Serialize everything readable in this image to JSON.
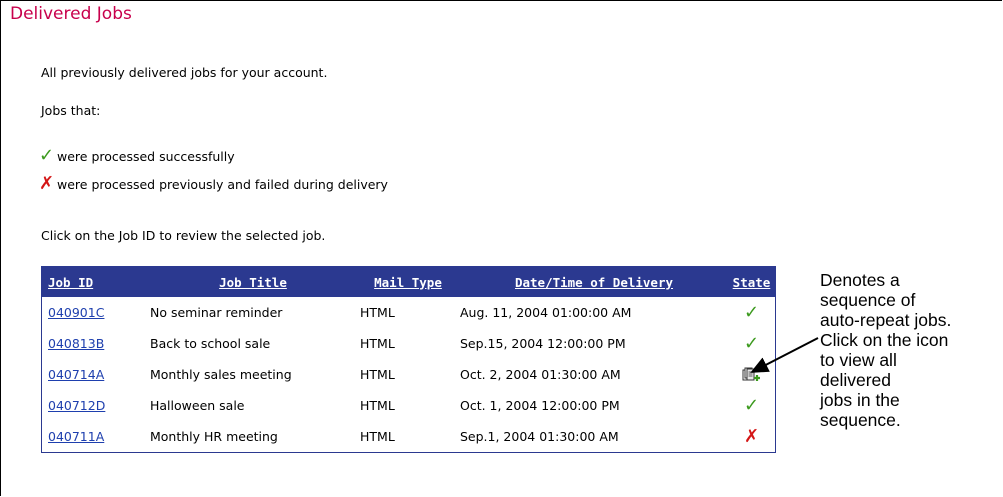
{
  "page": {
    "title": "Delivered Jobs",
    "intro": "All previously delivered jobs for your account.",
    "jobs_that": "Jobs that:",
    "legend_success": "were processed successfully",
    "legend_failed": "were processed previously and failed during delivery",
    "instruction": "Click on the Job ID to review the selected job."
  },
  "table": {
    "headers": {
      "job_id": "Job ID",
      "job_title": "Job Title",
      "mail_type": "Mail Type",
      "date": "Date/Time of Delivery",
      "state": "State"
    },
    "rows": [
      {
        "id": "040901C",
        "title": "No seminar reminder",
        "mail": "HTML",
        "date": "Aug. 11, 2004 01:00:00 AM",
        "state": "success"
      },
      {
        "id": "040813B",
        "title": "Back to school sale",
        "mail": "HTML",
        "date": "Sep.15, 2004 12:00:00 PM",
        "state": "success"
      },
      {
        "id": "040714A",
        "title": "Monthly sales meeting",
        "mail": "HTML",
        "date": "Oct. 2, 2004 01:30:00 AM",
        "state": "sequence"
      },
      {
        "id": "040712D",
        "title": "Halloween sale",
        "mail": "HTML",
        "date": "Oct. 1, 2004 12:00:00 PM",
        "state": "success"
      },
      {
        "id": "040711A",
        "title": "Monthly HR meeting",
        "mail": "HTML",
        "date": "Sep.1, 2004 01:30:00 AM",
        "state": "failed"
      }
    ]
  },
  "annotation": {
    "lines": [
      "Denotes a",
      "sequence of",
      "auto-repeat jobs.",
      "Click on the icon",
      "to view all",
      "delivered",
      "jobs in the",
      "sequence."
    ]
  },
  "icons": {
    "success": "check-icon",
    "failed": "cross-icon",
    "sequence": "auto-repeat-sequence-icon"
  },
  "colors": {
    "title": "#c8004c",
    "header_bg": "#2b3990",
    "link": "#1e3fae",
    "success": "#3c9a1e",
    "failed": "#d41616"
  }
}
